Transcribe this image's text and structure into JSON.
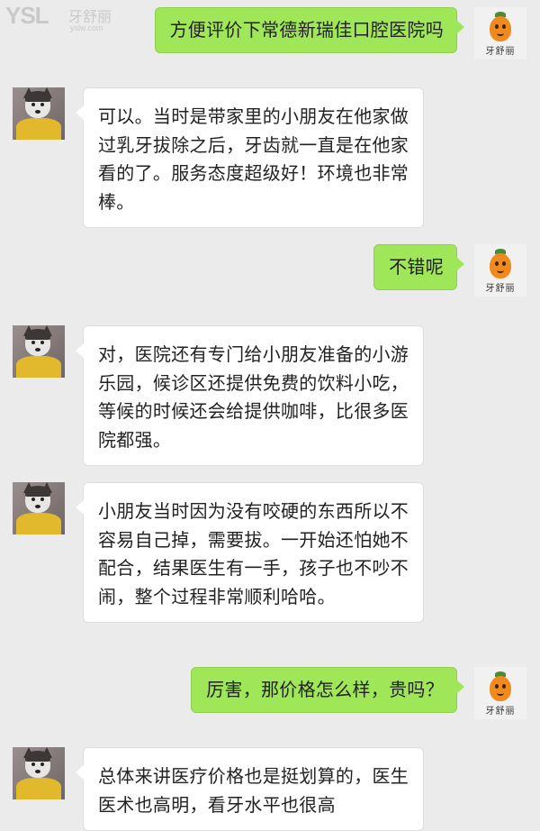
{
  "watermark": {
    "brand": "YSL",
    "name": "牙舒丽",
    "url": "yslw.com"
  },
  "my_avatar_caption": "牙舒丽",
  "messages": [
    {
      "from": "me",
      "text": "方便评价下常德新瑞佳口腔医院吗"
    },
    {
      "from": "other",
      "text": "可以。当时是带家里的小朋友在他家做过乳牙拔除之后，牙齿就一直是在他家看的了。服务态度超级好！环境也非常棒。"
    },
    {
      "from": "me",
      "text": "不错呢"
    },
    {
      "from": "other",
      "text": "对，医院还有专门给小朋友准备的小游乐园，候诊区还提供免费的饮料小吃，等候的时候还会给提供咖啡，比很多医院都强。"
    },
    {
      "from": "other",
      "text": "小朋友当时因为没有咬硬的东西所以不容易自己掉，需要拔。一开始还怕她不配合，结果医生有一手，孩子也不吵不闹，整个过程非常顺利哈哈。"
    },
    {
      "from": "me",
      "text": "厉害，那价格怎么样，贵吗？"
    },
    {
      "from": "other",
      "text": "总体来讲医疗价格也是挺划算的，医生医术也高明，看牙水平也很高"
    }
  ]
}
